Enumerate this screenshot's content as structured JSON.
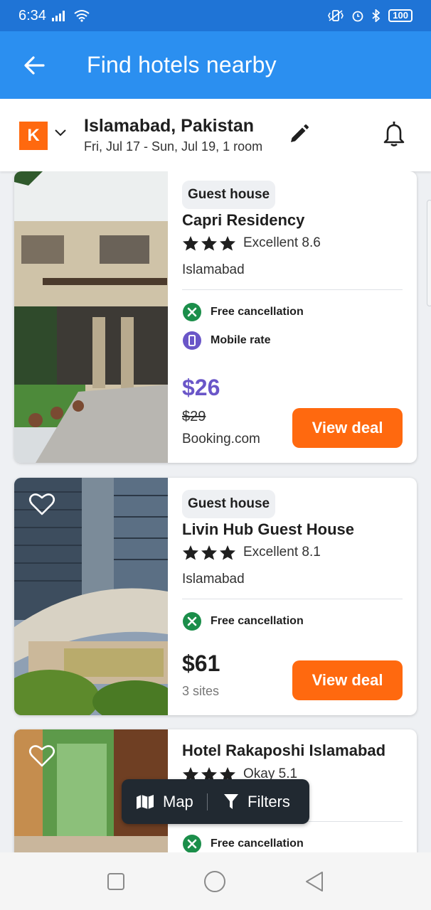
{
  "status_bar": {
    "time": "6:34",
    "battery": "100"
  },
  "app_bar": {
    "title": "Find hotels nearby"
  },
  "summary": {
    "logo_letter": "K",
    "city": "Islamabad, Pakistan",
    "dates": "Fri, Jul 17 - Sun, Jul 19, 1 room"
  },
  "colors": {
    "brand_orange": "#ff690f",
    "app_blue": "#2b8ff0",
    "price_purple": "#6a56c8",
    "perk_green": "#1b8e4a"
  },
  "hotels": [
    {
      "type": "Guest house",
      "name": "Capri Residency",
      "stars": 3,
      "rating": "Excellent 8.6",
      "city": "Islamabad",
      "perks": [
        "Free cancellation",
        "Mobile rate"
      ],
      "price": "$26",
      "old_price": "$29",
      "provider": "Booking.com",
      "deal_label": "View deal"
    },
    {
      "type": "Guest house",
      "name": "Livin Hub Guest House",
      "stars": 3,
      "rating": "Excellent 8.1",
      "city": "Islamabad",
      "perks": [
        "Free cancellation"
      ],
      "price": "$61",
      "sites": "3 sites",
      "deal_label": "View deal"
    },
    {
      "name": "Hotel Rakaposhi Islamabad",
      "stars": 3,
      "rating": "Okay 5.1",
      "perks": [
        "Free cancellation"
      ]
    }
  ],
  "floating_bar": {
    "map_label": "Map",
    "filters_label": "Filters"
  }
}
